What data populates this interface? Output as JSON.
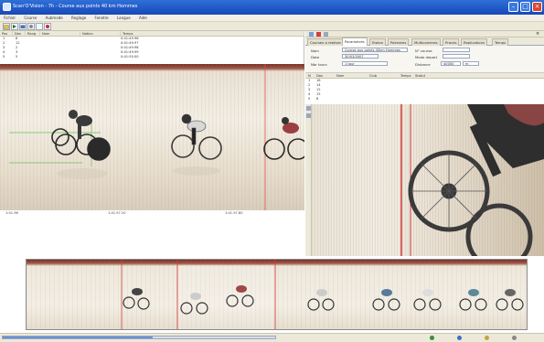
{
  "window": {
    "title": "Scan'O'Vision - 7h - Course aux points 40 km Hommes",
    "buttons": [
      "minimize",
      "maximize",
      "close"
    ]
  },
  "menu": [
    "Fichier",
    "Course",
    "Aubmode",
    "Reglage",
    "Fenetre",
    "Langue",
    "Aide"
  ],
  "results_table": {
    "headers": [
      "Pos",
      "Dos",
      "Rang",
      "Nom",
      "Nation",
      "Temps"
    ],
    "rows": [
      {
        "pos": "1",
        "dos": "8",
        "time": "0:41:49.96"
      },
      {
        "pos": "2",
        "dos": "12",
        "time": "0:41:49.97"
      },
      {
        "pos": "3",
        "dos": "2",
        "time": "0:41:49.98"
      },
      {
        "pos": "4",
        "dos": "3",
        "time": "0:41:49.99"
      },
      {
        "pos": "5",
        "dos": "5",
        "time": "0:41:50.00"
      }
    ]
  },
  "timeline_ticks": [
    "1:41.96",
    "1:41.97.20",
    "1:41.97.80"
  ],
  "right_tabs": [
    {
      "label": "Courses a realiser",
      "active": false
    },
    {
      "label": "Parametres",
      "active": true
    },
    {
      "label": "Etalon",
      "active": false
    },
    {
      "label": "Palmares",
      "active": false
    },
    {
      "label": "Multicameras",
      "active": false
    },
    {
      "label": "Proces",
      "active": false
    },
    {
      "label": "Replications",
      "active": false
    },
    {
      "label": "Temps",
      "active": false
    }
  ],
  "form": {
    "name_label": "Nom",
    "name_value": "Course aux points 40km Hommes",
    "date_label": "Date",
    "date_value": "30/03/2007",
    "tours_label": "Nbr tours",
    "tours_value": "1 tour",
    "dist_label": "Distance",
    "dist_value": "40000",
    "dist_unit": "m",
    "cat_label": "N° course",
    "mode_label": "Mode depart"
  },
  "right_grid": {
    "headers": [
      "N",
      "Dos",
      "Nom",
      "Club",
      "Temps",
      "Statut"
    ],
    "rows": [
      "1",
      "2",
      "3",
      "4",
      "5"
    ],
    "dos": [
      "18",
      "14",
      "12",
      "15",
      "8"
    ]
  }
}
